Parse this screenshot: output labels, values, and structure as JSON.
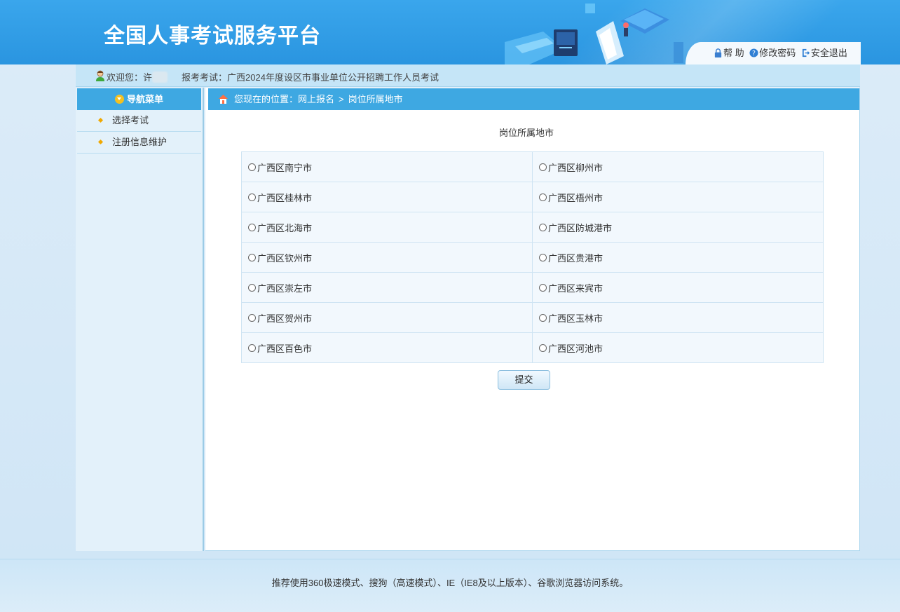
{
  "header": {
    "site_title": "全国人事考试服务平台",
    "links": [
      {
        "label": "帮 助",
        "icon": "lock-icon"
      },
      {
        "label": "修改密码",
        "icon": "question-icon"
      },
      {
        "label": "安全退出",
        "icon": "logout-icon"
      }
    ]
  },
  "welcome": {
    "greeting": "欢迎您：许",
    "exam_label": "报考考试：",
    "exam_name": "广西2024年度设区市事业单位公开招聘工作人员考试"
  },
  "sidebar": {
    "heading": "导航菜单",
    "items": [
      {
        "label": "选择考试"
      },
      {
        "label": "注册信息维护"
      }
    ]
  },
  "breadcrumb": {
    "prefix": "您现在的位置：",
    "level1": "网上报名",
    "separator": ">",
    "level2": "岗位所属地市"
  },
  "form": {
    "title": "岗位所属地市",
    "rows": [
      [
        "广西区南宁市",
        "广西区柳州市"
      ],
      [
        "广西区桂林市",
        "广西区梧州市"
      ],
      [
        "广西区北海市",
        "广西区防城港市"
      ],
      [
        "广西区钦州市",
        "广西区贵港市"
      ],
      [
        "广西区崇左市",
        "广西区来宾市"
      ],
      [
        "广西区贺州市",
        "广西区玉林市"
      ],
      [
        "广西区百色市",
        "广西区河池市"
      ]
    ],
    "submit_label": "提交"
  },
  "footer": {
    "text": "推荐使用360极速模式、搜狗（高速模式）、IE（IE8及以上版本）、谷歌浏览器访问系统。"
  },
  "colors": {
    "banner": "#2a95e0",
    "nav_header": "#3ea8e2",
    "welcome_bar": "#c5e5f7",
    "table_bg": "#f2f8fd"
  }
}
